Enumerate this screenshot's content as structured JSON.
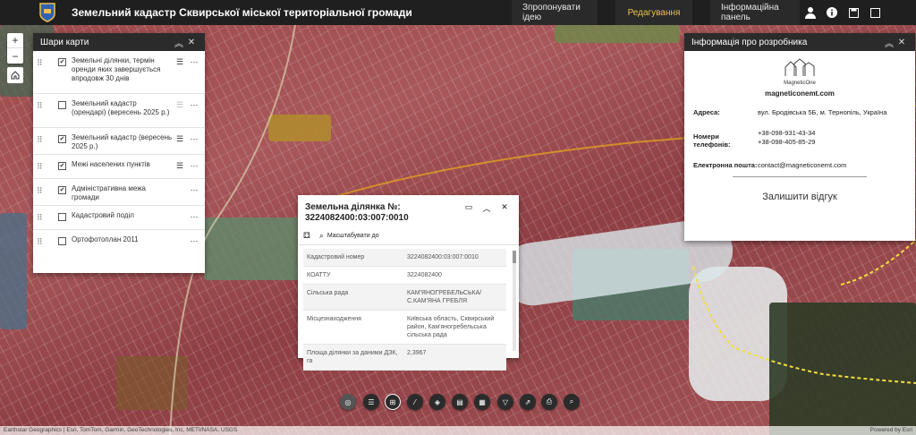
{
  "header": {
    "title": "Земельний кадастр Сквирської міської територіальної громади",
    "buttons": [
      "Зпропонувати ідею",
      "Редагування",
      "Інформаційна панель"
    ]
  },
  "layers_panel": {
    "title": "Шари карти",
    "layers": [
      {
        "label": "Земельні ділянки, термін оренди яких завершується впродовж 30 днів",
        "checked": true
      },
      {
        "label": "Земельний кадастр (орендарі) (вересень 2025 р.)",
        "checked": false
      },
      {
        "label": "Земельний кадастр (вересень 2025 р.)",
        "checked": true
      },
      {
        "label": "Межі населених пунктів",
        "checked": true
      },
      {
        "label": "Адміністративна межа громади",
        "checked": true
      },
      {
        "label": "Кадастровий поділ",
        "checked": false
      },
      {
        "label": "Ортофотоплан 2011",
        "checked": false
      }
    ]
  },
  "developer_panel": {
    "title": "Інформація про розробника",
    "logo_text": "MagneticOne",
    "website": "magneticonemt.com",
    "address_label": "Адреса:",
    "address": "вул. Бродівська 5Б, м. Тернопіль, Україна",
    "phones_label": "Номери телефонів:",
    "phone1": "+38-098-931-43-34",
    "phone2": "+38-098-405-85-29",
    "email_label": "Електронна пошта:",
    "email": "contact@magneticonemt.com",
    "feedback": "Залишити відгук"
  },
  "popup": {
    "title": "Земельна ділянка №: 3224082400:03:007:0010",
    "zoom_to": "Масштабувати до",
    "rows": [
      {
        "k": "Кадастровий номер",
        "v": "3224082400:03:007:0010"
      },
      {
        "k": "КОАТТУ",
        "v": "3224082400"
      },
      {
        "k": "Сільська рада",
        "v": "КАМ'ЯНОГРЕБЕЛЬСЬКА/ С.КАМ'ЯНА ГРЕБЛЯ"
      },
      {
        "k": "Місцезнаходження",
        "v": "Київська область, Сквирський район, Кам'яногребельська сільська рада"
      },
      {
        "k": "Площа ділянки за даними ДЗК, га",
        "v": "2,3967"
      }
    ]
  },
  "attribution": {
    "left": "Earthstar Geographics | Esri, TomTom, Garmin, GeoTechnologies, Inc, METI/NASA, USGS",
    "right": "Powered by Esri"
  },
  "colors": {
    "header": "#1f1f1f",
    "active": "#e9c24b",
    "parcel": "#a3535a"
  }
}
